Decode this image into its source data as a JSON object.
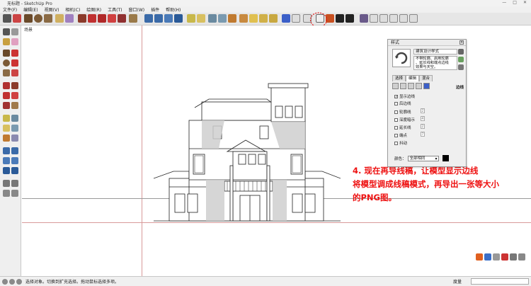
{
  "window": {
    "title": "无标题 - SketchUp Pro"
  },
  "menu": {
    "items": [
      "文件(F)",
      "编辑(E)",
      "视图(V)",
      "相机(C)",
      "绘图(R)",
      "工具(T)",
      "窗口(W)",
      "插件",
      "帮助(H)"
    ]
  },
  "scene": {
    "label": "场景"
  },
  "panel": {
    "title": "样式",
    "style_name": "建筑设计样式",
    "style_desc": [
      "不带轮廓、启用轮廓",
      "、延长线和端点边线",
      "效果与天空。"
    ],
    "tabs": [
      "选择",
      "编辑",
      "混合"
    ],
    "edit_section": "边线",
    "options": [
      {
        "label": "显示边线",
        "checked": true
      },
      {
        "label": "后边线",
        "checked": false
      },
      {
        "label": "轮廓线",
        "checked": false,
        "value": "2"
      },
      {
        "label": "深度暗示",
        "checked": false,
        "value": "4"
      },
      {
        "label": "延长线",
        "checked": false,
        "value": "2"
      },
      {
        "label": "端点",
        "checked": false,
        "value": "7"
      },
      {
        "label": "抖动",
        "checked": false
      }
    ],
    "color_label": "颜色：",
    "color_value": "全部相同"
  },
  "note": {
    "lines": [
      "4. 现在再导线稿，让模型显示边线",
      "将模型调成线稿模式，再导出一张等大小",
      "的PNG图。"
    ]
  },
  "status": {
    "text": "选择对象。切换到扩充选择。拖动鼠标选择多项。",
    "measure_label": "度量"
  },
  "colors": {
    "accent": "#e11",
    "highlight": "#3b5fc8"
  }
}
